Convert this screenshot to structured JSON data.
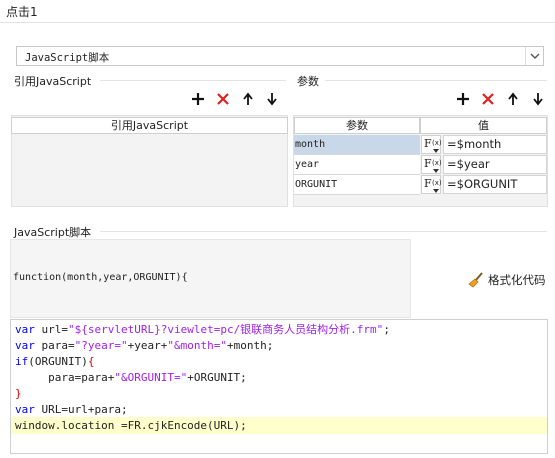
{
  "title": "点击1",
  "dropdown": {
    "selected": "JavaScript脚本"
  },
  "ref_section": {
    "label": "引用JavaScript",
    "column_header": "引用JavaScript"
  },
  "param_section": {
    "label": "参数",
    "headers": {
      "name": "参数",
      "value": "值"
    },
    "rows": [
      {
        "name": "month",
        "value": "=$month",
        "selected": true
      },
      {
        "name": "year",
        "value": "=$year",
        "selected": false
      },
      {
        "name": "ORGUNIT",
        "value": "=$ORGUNIT",
        "selected": false
      }
    ]
  },
  "script_section": {
    "label": "JavaScript脚本",
    "function_signature": "function(month,year,ORGUNIT){",
    "format_button": "格式化代码"
  },
  "editor": {
    "highlight_line": 6,
    "lines": [
      [
        {
          "t": "var",
          "c": "kw"
        },
        {
          "t": " url="
        },
        {
          "t": "\"${servletURL}?viewlet=pc/银联商务人员结构分析.frm\"",
          "c": "str"
        },
        {
          "t": ";"
        }
      ],
      [
        {
          "t": "var",
          "c": "kw"
        },
        {
          "t": " para="
        },
        {
          "t": "\"?year=\"",
          "c": "str"
        },
        {
          "t": "+year+"
        },
        {
          "t": "\"&month=\"",
          "c": "str"
        },
        {
          "t": "+month;"
        }
      ],
      [
        {
          "t": "if",
          "c": "kw"
        },
        {
          "t": "(ORGUNIT)"
        },
        {
          "t": "{",
          "c": "red"
        }
      ],
      [
        {
          "t": "     para=para+"
        },
        {
          "t": "\"&ORGUNIT=\"",
          "c": "str"
        },
        {
          "t": "+ORGUNIT;"
        }
      ],
      [
        {
          "t": "}",
          "c": "red"
        }
      ],
      [
        {
          "t": "var",
          "c": "kw"
        },
        {
          "t": " URL=url+para;"
        }
      ],
      [
        {
          "t": "window.location =FR.cjkEncode(URL);"
        }
      ]
    ]
  },
  "colors": {
    "add": "#111111",
    "delete": "#e02020",
    "selected_row": "#c8d8e8",
    "keyword": "#0000ff",
    "string": "#a020f0",
    "brace": "#d00000",
    "highlight": "#ffffcc"
  },
  "icons": {
    "toolbar": [
      "plus-icon",
      "delete-x-icon",
      "arrow-up-icon",
      "arrow-down-icon"
    ],
    "format": "broom-icon",
    "dropdown": "chevron-down-icon"
  }
}
